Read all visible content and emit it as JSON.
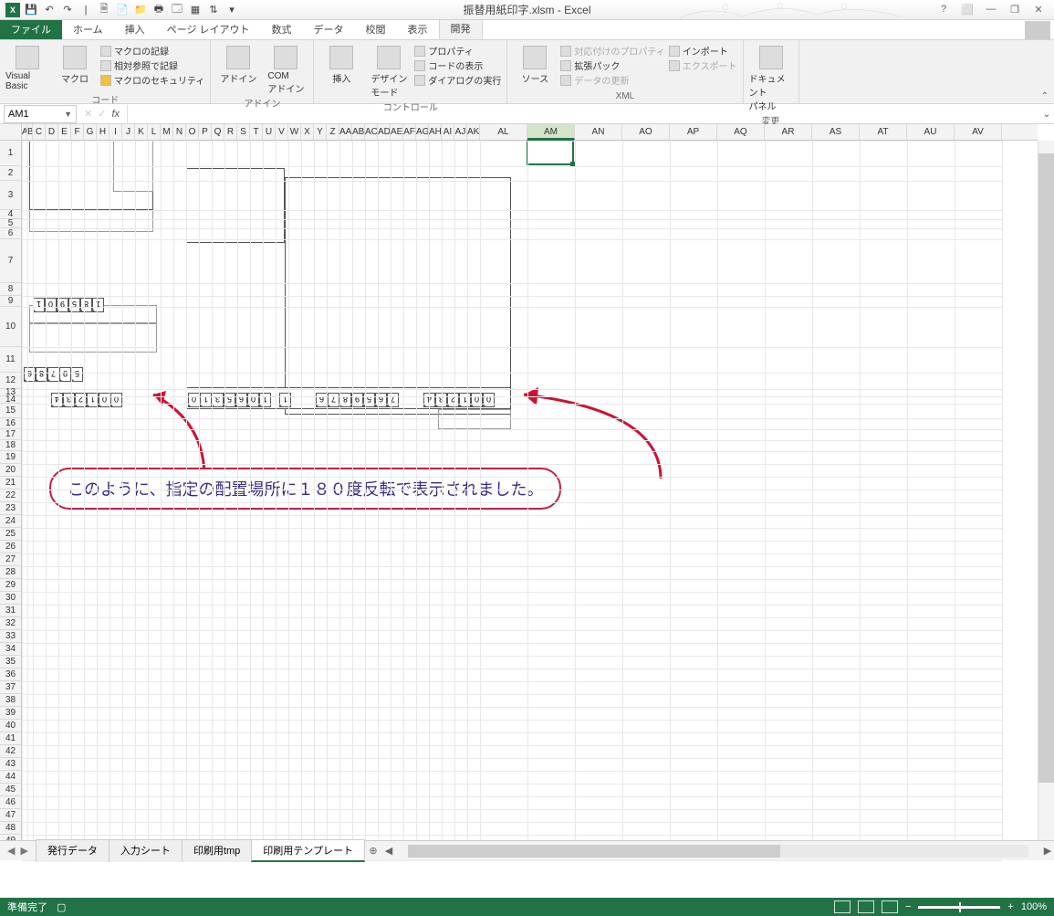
{
  "title": "振替用紙印字.xlsm - Excel",
  "qat_icons": [
    "excel",
    "save",
    "undo",
    "redo",
    "|",
    "new",
    "open",
    "folder",
    "print",
    "preview",
    "table",
    "sort",
    "filter",
    "dropdown"
  ],
  "window_controls": [
    "?",
    "⬜",
    "—",
    "❐",
    "✕"
  ],
  "ribbon_tabs": [
    "ファイル",
    "ホーム",
    "挿入",
    "ページ レイアウト",
    "数式",
    "データ",
    "校閲",
    "表示",
    "開発"
  ],
  "active_ribbon_tab": "開発",
  "ribbon": {
    "code": {
      "vb": "Visual Basic",
      "macro": "マクロ",
      "rec": "マクロの記録",
      "relref": "相対参照で記録",
      "sec": "マクロのセキュリティ",
      "label": "コード"
    },
    "addins": {
      "addin": "アドイン",
      "com": "COM\nアドイン",
      "label": "アドイン"
    },
    "controls": {
      "insert": "挿入",
      "design": "デザイン\nモード",
      "prop": "プロパティ",
      "viewcode": "コードの表示",
      "dialog": "ダイアログの実行",
      "label": "コントロール"
    },
    "xml": {
      "source": "ソース",
      "mapprop": "対応付けのプロパティ",
      "exp": "拡張パック",
      "refresh": "データの更新",
      "import": "インポート",
      "export": "エクスポート",
      "label": "XML"
    },
    "modify": {
      "docpanel": "ドキュメント\nパネル",
      "label": "変更"
    }
  },
  "namebox": "AM1",
  "formula": "",
  "columns": [
    "A",
    "B",
    "C",
    "D",
    "E",
    "F",
    "G",
    "H",
    "I",
    "J",
    "K",
    "L",
    "M",
    "N",
    "O",
    "P",
    "Q",
    "R",
    "S",
    "T",
    "U",
    "V",
    "W",
    "X",
    "Y",
    "Z",
    "AA",
    "AB",
    "AC",
    "AD",
    "AE",
    "AF",
    "AG",
    "AH",
    "AI",
    "AJ",
    "AK",
    "AL",
    "AM",
    "AN",
    "AO",
    "AP",
    "AQ",
    "AR",
    "AS",
    "AT",
    "AU",
    "AV"
  ],
  "selected_col": "AM",
  "row_count": 50,
  "digits_r7": [
    "1",
    "0",
    "9",
    "5",
    "8",
    "1"
  ],
  "digits_r10": [
    "6",
    "8",
    "7",
    "9",
    "5"
  ],
  "digits_r12a": [
    "4",
    "3",
    "2",
    "1",
    "0",
    "0"
  ],
  "digits_r12b": [
    "0",
    "1",
    "3",
    "5",
    "6",
    "0",
    "1"
  ],
  "digits_r12c": [
    "1"
  ],
  "digits_r12d": [
    "6",
    "7",
    "8",
    "9",
    "5",
    "6",
    "7"
  ],
  "digits_r12e": [
    "4",
    "3",
    "2",
    "1",
    "0",
    "0"
  ],
  "annotation": "このように、指定の配置場所に１８０度反転で表示されました。",
  "sheets": [
    "発行データ",
    "入力シート",
    "印刷用tmp",
    "印刷用テンプレート"
  ],
  "active_sheet": "印刷用テンプレート",
  "status_text": "準備完了",
  "zoom": "100%"
}
